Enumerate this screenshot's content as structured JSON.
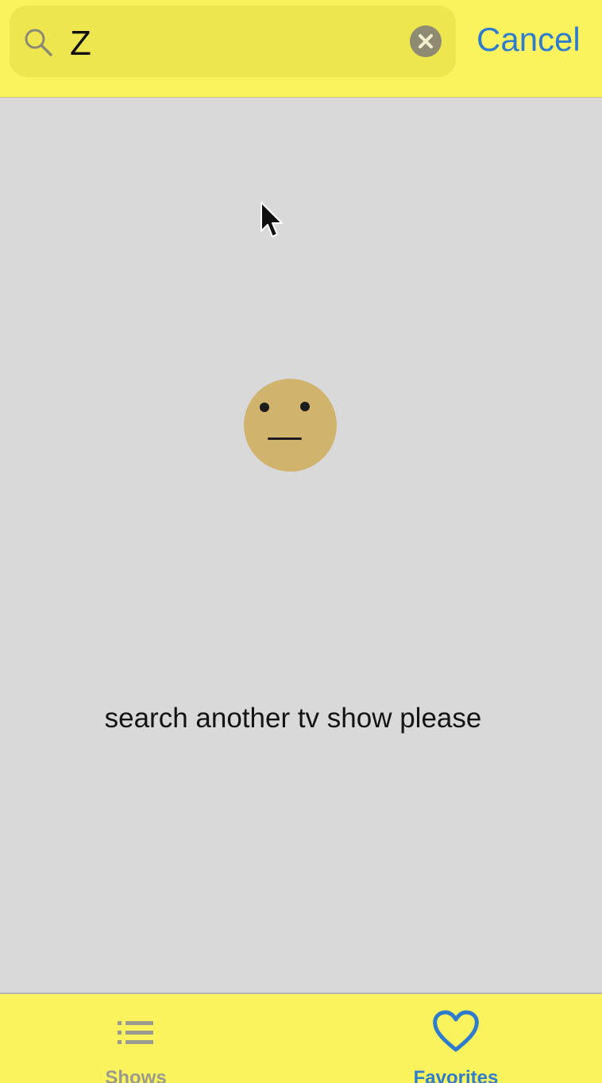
{
  "search": {
    "query": "Z",
    "cancel_label": "Cancel"
  },
  "empty_state": {
    "icon": "neutral-face-icon",
    "message": "search another tv show please"
  },
  "tab_bar": {
    "tabs": [
      {
        "label": "Shows",
        "icon": "list-icon",
        "active": false
      },
      {
        "label": "Favorites",
        "icon": "heart-icon",
        "active": true
      }
    ]
  },
  "colors": {
    "header_background": "#fbf35e",
    "search_field_background": "#ede64f",
    "content_background": "#d9d9d9",
    "accent": "#2f7ccd",
    "face": "#d0b36d",
    "inactive_tab": "#9a9a8e"
  }
}
